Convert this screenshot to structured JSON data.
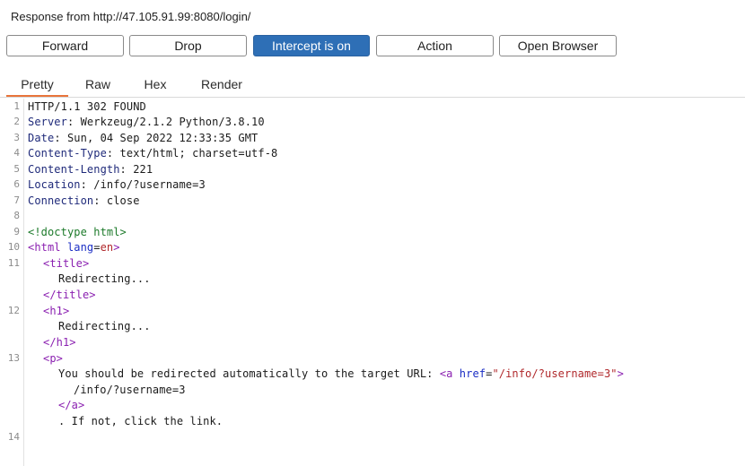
{
  "window_title": "Response from http://47.105.91.99:8080/login/",
  "buttons": {
    "forward": "Forward",
    "drop": "Drop",
    "intercept": "Intercept is on",
    "action": "Action",
    "open_browser": "Open Browser"
  },
  "tabs": {
    "pretty": "Pretty",
    "raw": "Raw",
    "hex": "Hex",
    "render": "Render"
  },
  "line_numbers": [
    "1",
    "2",
    "3",
    "4",
    "5",
    "6",
    "7",
    "8",
    "9",
    "10",
    "11",
    "12",
    "13",
    "14"
  ],
  "headers": {
    "status": "HTTP/1.1 302 FOUND",
    "server_key": "Server",
    "server_val": " Werkzeug/2.1.2 Python/3.8.10",
    "date_key": "Date",
    "date_val": " Sun, 04 Sep 2022 12:33:35 GMT",
    "ctype_key": "Content-Type",
    "ctype_val": " text/html; charset=utf-8",
    "clen_key": "Content-Length",
    "clen_val": " 221",
    "loc_key": "Location",
    "loc_val": " /info/?username=3",
    "conn_key": "Connection",
    "conn_val": " close",
    "colon": ":"
  },
  "body": {
    "doctype": "<!doctype html>",
    "html_open": "<html",
    "lang_attr": " lang",
    "eq": "=",
    "lang_val": "en",
    "gt": ">",
    "title_open": "<title>",
    "redirecting_1": "Redirecting...",
    "title_close": "</title>",
    "h1_open": "<h1>",
    "redirecting_2": "Redirecting...",
    "h1_close": "</h1>",
    "p_open": "<p>",
    "p_text": "You should be redirected automatically to the target URL: ",
    "a_open": "<a",
    "href_attr": " href",
    "href_eq": "=",
    "href_val": "\"/info/?username=3\"",
    "a_gt": ">",
    "link_text": "/info/?username=3",
    "a_close": "</a>",
    "tail_text": ". If not, click the link."
  }
}
